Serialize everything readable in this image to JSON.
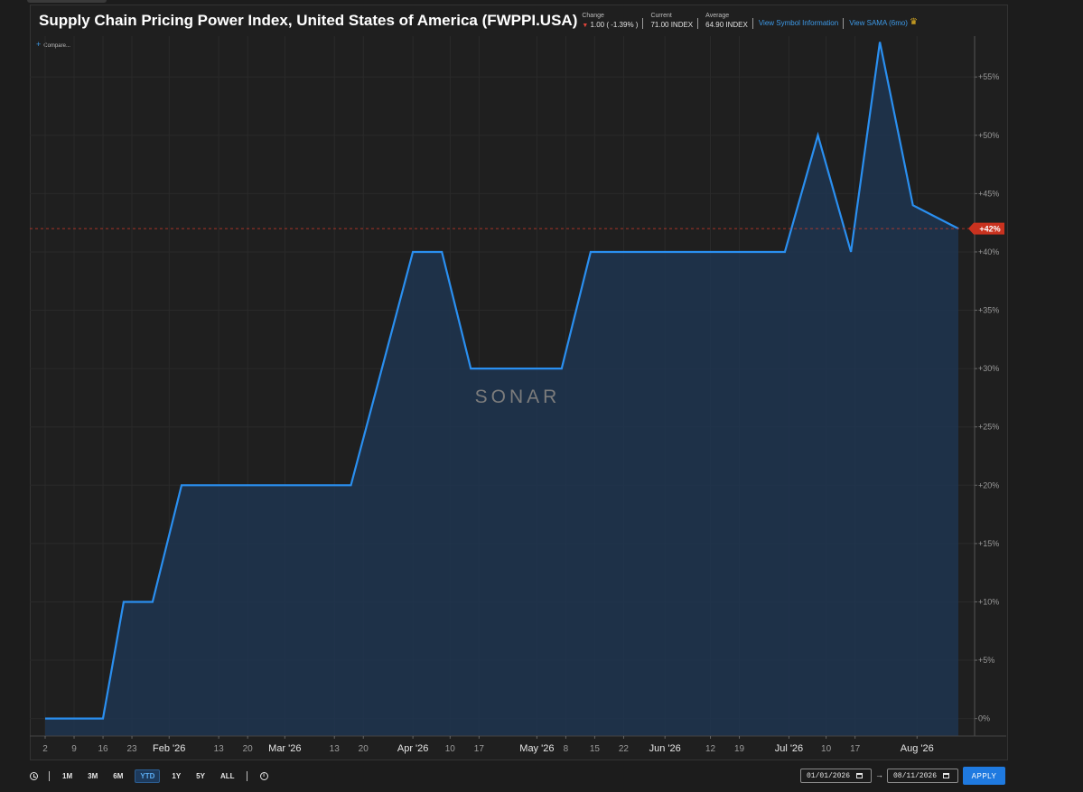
{
  "header": {
    "title": "Supply Chain Pricing Power Index, United States of America (FWPPI.USA)",
    "change_label": "Change",
    "change_value": "1.00 ( -1.39% )",
    "current_label": "Current",
    "current_value": "71.00 INDEX",
    "average_label": "Average",
    "average_value": "64.90 INDEX",
    "link_symbol_info": "View Symbol Information",
    "link_sama": "View SAMA (6mo)"
  },
  "compare_label": "Compare...",
  "watermark": "SONAR",
  "colors": {
    "line": "#2a8ff0",
    "area": "#1f3550",
    "current_marker": "#c9321f",
    "reference_line": "#d23a2a"
  },
  "toolbar": {
    "ranges": [
      "1M",
      "3M",
      "6M",
      "YTD",
      "1Y",
      "5Y",
      "ALL"
    ],
    "active_range": "YTD",
    "start_date": "01/01/2026",
    "end_date": "08/11/2026",
    "apply_label": "APPLY"
  },
  "chart_data": {
    "type": "area",
    "x_unit": "date",
    "x": [
      "2026-01-02",
      "2026-01-16",
      "2026-01-21",
      "2026-01-28",
      "2026-02-04",
      "2026-03-17",
      "2026-04-01",
      "2026-04-08",
      "2026-04-15",
      "2026-05-07",
      "2026-05-14",
      "2026-06-30",
      "2026-07-08",
      "2026-07-16",
      "2026-07-23",
      "2026-07-31",
      "2026-08-11"
    ],
    "values": [
      0,
      0,
      10,
      10,
      20,
      20,
      40,
      40,
      30,
      30,
      40,
      40,
      50,
      40,
      58,
      44,
      42
    ],
    "ylim": [
      -1.5,
      58.5
    ],
    "y_ticks": [
      0,
      5,
      10,
      15,
      20,
      25,
      30,
      35,
      40,
      45,
      50,
      55
    ],
    "y_tick_labels": [
      "0%",
      "+5%",
      "+10%",
      "+15%",
      "+20%",
      "+25%",
      "+30%",
      "+35%",
      "+40%",
      "+45%",
      "+50%",
      "+55%"
    ],
    "x_ticks": [
      {
        "date": "2026-01-02",
        "label": "2"
      },
      {
        "date": "2026-01-09",
        "label": "9"
      },
      {
        "date": "2026-01-16",
        "label": "16"
      },
      {
        "date": "2026-01-23",
        "label": "23"
      },
      {
        "date": "2026-02-01",
        "label": "Feb '26",
        "month": true
      },
      {
        "date": "2026-02-13",
        "label": "13"
      },
      {
        "date": "2026-02-20",
        "label": "20"
      },
      {
        "date": "2026-03-01",
        "label": "Mar '26",
        "month": true
      },
      {
        "date": "2026-03-13",
        "label": "13"
      },
      {
        "date": "2026-03-20",
        "label": "20"
      },
      {
        "date": "2026-04-01",
        "label": "Apr '26",
        "month": true
      },
      {
        "date": "2026-04-10",
        "label": "10"
      },
      {
        "date": "2026-04-17",
        "label": "17"
      },
      {
        "date": "2026-05-01",
        "label": "May '26",
        "month": true
      },
      {
        "date": "2026-05-08",
        "label": "8"
      },
      {
        "date": "2026-05-15",
        "label": "15"
      },
      {
        "date": "2026-05-22",
        "label": "22"
      },
      {
        "date": "2026-06-01",
        "label": "Jun '26",
        "month": true
      },
      {
        "date": "2026-06-12",
        "label": "12"
      },
      {
        "date": "2026-06-19",
        "label": "19"
      },
      {
        "date": "2026-07-01",
        "label": "Jul '26",
        "month": true
      },
      {
        "date": "2026-07-10",
        "label": "10"
      },
      {
        "date": "2026-07-17",
        "label": "17"
      },
      {
        "date": "2026-08-01",
        "label": "Aug '26",
        "month": true
      }
    ],
    "current_value": 42,
    "current_label": "+42%",
    "grid": true,
    "axis_side": "right"
  }
}
